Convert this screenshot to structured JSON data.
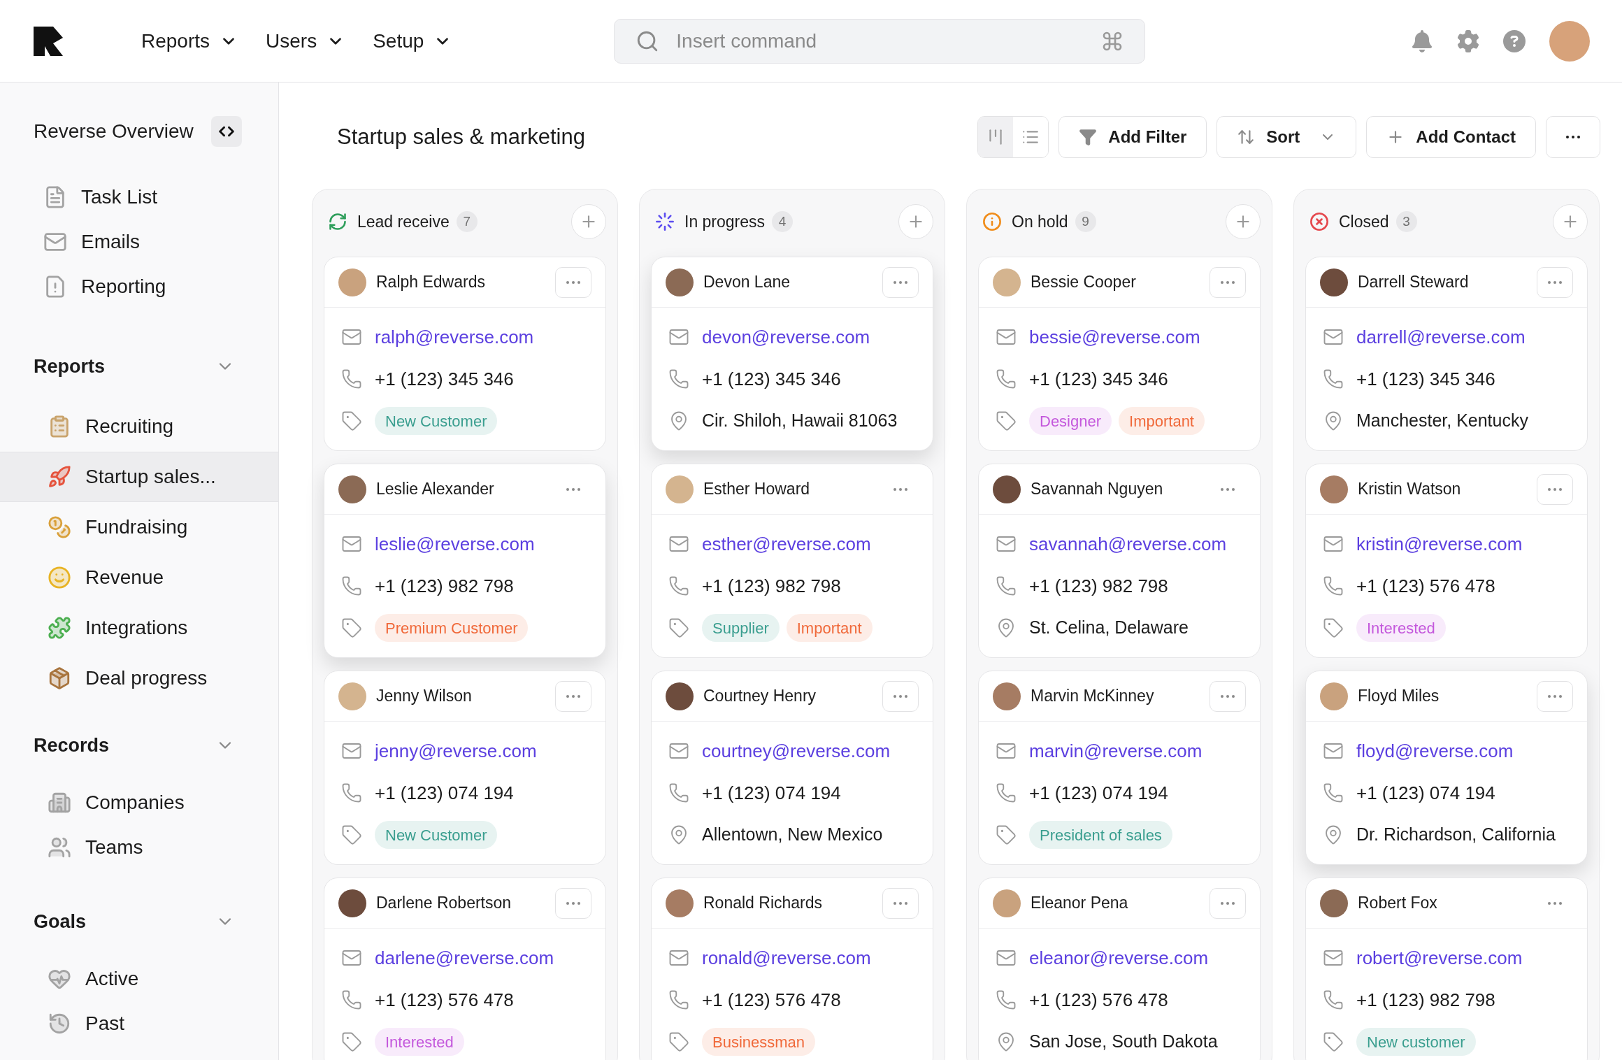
{
  "topbar": {
    "nav": [
      {
        "label": "Reports"
      },
      {
        "label": "Users"
      },
      {
        "label": "Setup"
      }
    ],
    "search": {
      "placeholder": "Insert command"
    }
  },
  "sidebar": {
    "title": "Reverse Overview",
    "items": [
      {
        "label": "Task List",
        "selected": false
      },
      {
        "label": "Emails",
        "selected": false
      },
      {
        "label": "Reporting",
        "selected": false
      }
    ],
    "sections": [
      {
        "title": "Reports",
        "expanded": true,
        "items": [
          {
            "label": "Recruiting",
            "selected": false
          },
          {
            "label": "Startup sales...",
            "selected": true
          },
          {
            "label": "Fundraising",
            "selected": false
          },
          {
            "label": "Revenue",
            "selected": false
          },
          {
            "label": "Integrations",
            "selected": false
          },
          {
            "label": "Deal progress",
            "selected": false
          }
        ]
      },
      {
        "title": "Records",
        "expanded": true,
        "items": [
          {
            "label": "Companies",
            "selected": false
          },
          {
            "label": "Teams",
            "selected": false
          }
        ]
      },
      {
        "title": "Goals",
        "expanded": true,
        "items": [
          {
            "label": "Active",
            "selected": false
          },
          {
            "label": "Past",
            "selected": false
          }
        ]
      }
    ]
  },
  "page": {
    "title": "Startup sales & marketing",
    "view_toggle": [
      {
        "kind": "board",
        "selected": true
      },
      {
        "kind": "list",
        "selected": false
      }
    ],
    "buttons": [
      {
        "kind": "filter",
        "label": "Add Filter"
      },
      {
        "kind": "sort",
        "label": "Sort"
      },
      {
        "kind": "add",
        "label": "Add Contact"
      },
      {
        "kind": "more"
      }
    ]
  },
  "columns": [
    {
      "kind": "lead",
      "title": "Lead receive",
      "count": "7",
      "cards": [
        {
          "name": "Ralph Edwards",
          "raised": false,
          "menu_outlined": true,
          "email": "ralph@reverse.com",
          "phone": "+1 (123) 345 346",
          "tags": [
            {
              "label": "New Customer",
              "color": "#3a9e8f"
            }
          ]
        },
        {
          "name": "Leslie Alexander",
          "raised": true,
          "menu_outlined": false,
          "email": "leslie@reverse.com",
          "phone": "+1 (123) 982 798",
          "tags": [
            {
              "label": "Premium Customer",
              "color": "#f0693a"
            }
          ]
        },
        {
          "name": "Jenny Wilson",
          "raised": false,
          "menu_outlined": true,
          "email": "jenny@reverse.com",
          "phone": "+1 (123) 074 194",
          "tags": [
            {
              "label": "New Customer",
              "color": "#3a9e8f"
            }
          ]
        },
        {
          "name": "Darlene Robertson",
          "raised": false,
          "menu_outlined": true,
          "email": "darlene@reverse.com",
          "phone": "+1 (123) 576 478",
          "tags": [
            {
              "label": "Interested",
              "color": "#c458dc"
            }
          ]
        }
      ]
    },
    {
      "kind": "progress",
      "title": "In progress",
      "count": "4",
      "cards": [
        {
          "name": "Devon Lane",
          "raised": true,
          "menu_outlined": true,
          "email": "devon@reverse.com",
          "phone": "+1 (123) 345 346",
          "location": "Cir. Shiloh, Hawaii 81063"
        },
        {
          "name": "Esther Howard",
          "raised": false,
          "menu_outlined": false,
          "email": "esther@reverse.com",
          "phone": "+1 (123) 982 798",
          "tags": [
            {
              "label": "Supplier",
              "color": "#3a9e8f"
            },
            {
              "label": "Important",
              "color": "#f0693a"
            }
          ]
        },
        {
          "name": "Courtney Henry",
          "raised": false,
          "menu_outlined": true,
          "email": "courtney@reverse.com",
          "phone": "+1 (123) 074 194",
          "location": "Allentown, New Mexico"
        },
        {
          "name": "Ronald Richards",
          "raised": false,
          "menu_outlined": true,
          "email": "ronald@reverse.com",
          "phone": "+1 (123) 576 478",
          "tags": [
            {
              "label": "Businessman",
              "color": "#f0693a"
            }
          ]
        }
      ]
    },
    {
      "kind": "hold",
      "title": "On hold",
      "count": "9",
      "cards": [
        {
          "name": "Bessie Cooper",
          "raised": false,
          "menu_outlined": true,
          "email": "bessie@reverse.com",
          "phone": "+1 (123) 345 346",
          "tags": [
            {
              "label": "Designer",
              "color": "#c458dc"
            },
            {
              "label": "Important",
              "color": "#f0693a"
            }
          ]
        },
        {
          "name": "Savannah Nguyen",
          "raised": false,
          "menu_outlined": false,
          "email": "savannah@reverse.com",
          "phone": "+1 (123) 982 798",
          "location": "St. Celina, Delaware"
        },
        {
          "name": "Marvin McKinney",
          "raised": false,
          "menu_outlined": true,
          "email": "marvin@reverse.com",
          "phone": "+1 (123) 074 194",
          "tags": [
            {
              "label": "President of sales",
              "color": "#3a9e8f"
            }
          ]
        },
        {
          "name": "Eleanor Pena",
          "raised": false,
          "menu_outlined": true,
          "email": "eleanor@reverse.com",
          "phone": "+1 (123) 576 478",
          "location": "San Jose, South Dakota"
        }
      ]
    },
    {
      "kind": "closed",
      "title": "Closed",
      "count": "3",
      "cards": [
        {
          "name": "Darrell Steward",
          "raised": false,
          "menu_outlined": true,
          "email": "darrell@reverse.com",
          "phone": "+1 (123) 345 346",
          "location": "Manchester, Kentucky"
        },
        {
          "name": "Kristin Watson",
          "raised": false,
          "menu_outlined": true,
          "email": "kristin@reverse.com",
          "phone": "+1 (123) 576 478",
          "tags": [
            {
              "label": "Interested",
              "color": "#c458dc"
            }
          ]
        },
        {
          "name": "Floyd Miles",
          "raised": true,
          "menu_outlined": true,
          "email": "floyd@reverse.com",
          "phone": "+1 (123) 074 194",
          "location": "Dr. Richardson, California"
        },
        {
          "name": "Robert Fox",
          "raised": false,
          "menu_outlined": false,
          "email": "robert@reverse.com",
          "phone": "+1 (123) 982 798",
          "tags": [
            {
              "label": "New customer",
              "color": "#3a9e8f"
            }
          ]
        }
      ]
    }
  ]
}
